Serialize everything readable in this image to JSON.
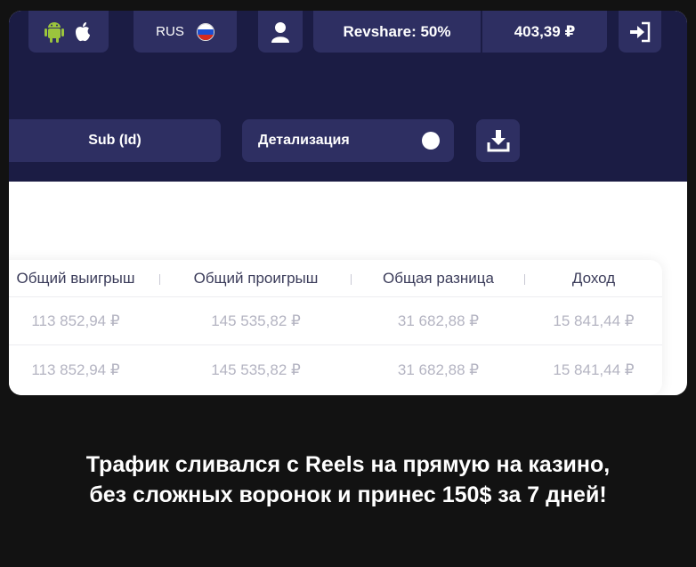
{
  "header": {
    "platform_icons": [
      "android-icon",
      "apple-icon"
    ],
    "language": {
      "label": "RUS",
      "flag": "russia-flag-icon"
    },
    "user_icon": "user-icon",
    "revshare_label": "Revshare: 50%",
    "balance": "403,39 ₽",
    "logout_icon": "logout-icon"
  },
  "filters": {
    "sub_id_label": "Sub (Id)",
    "detail_label": "Детализация",
    "download_icon": "download-icon"
  },
  "table": {
    "columns": [
      "Общий выигрыш",
      "Общий проигрыш",
      "Общая разница",
      "Доход"
    ],
    "rows": [
      [
        "113 852,94 ₽",
        "145 535,82 ₽",
        "31 682,88 ₽",
        "15 841,44 ₽"
      ],
      [
        "113 852,94 ₽",
        "145 535,82 ₽",
        "31 682,88 ₽",
        "15 841,44 ₽"
      ]
    ]
  },
  "caption": {
    "line1": "Трафик сливался с Reels на прямую на казино,",
    "line2": "без сложных воронок и принес 150$ за 7 дней!"
  },
  "colors": {
    "header_bg": "#1b1c44",
    "pill_bg": "#2e2f62",
    "page_bg": "#121212",
    "android_green": "#9bc53d"
  }
}
